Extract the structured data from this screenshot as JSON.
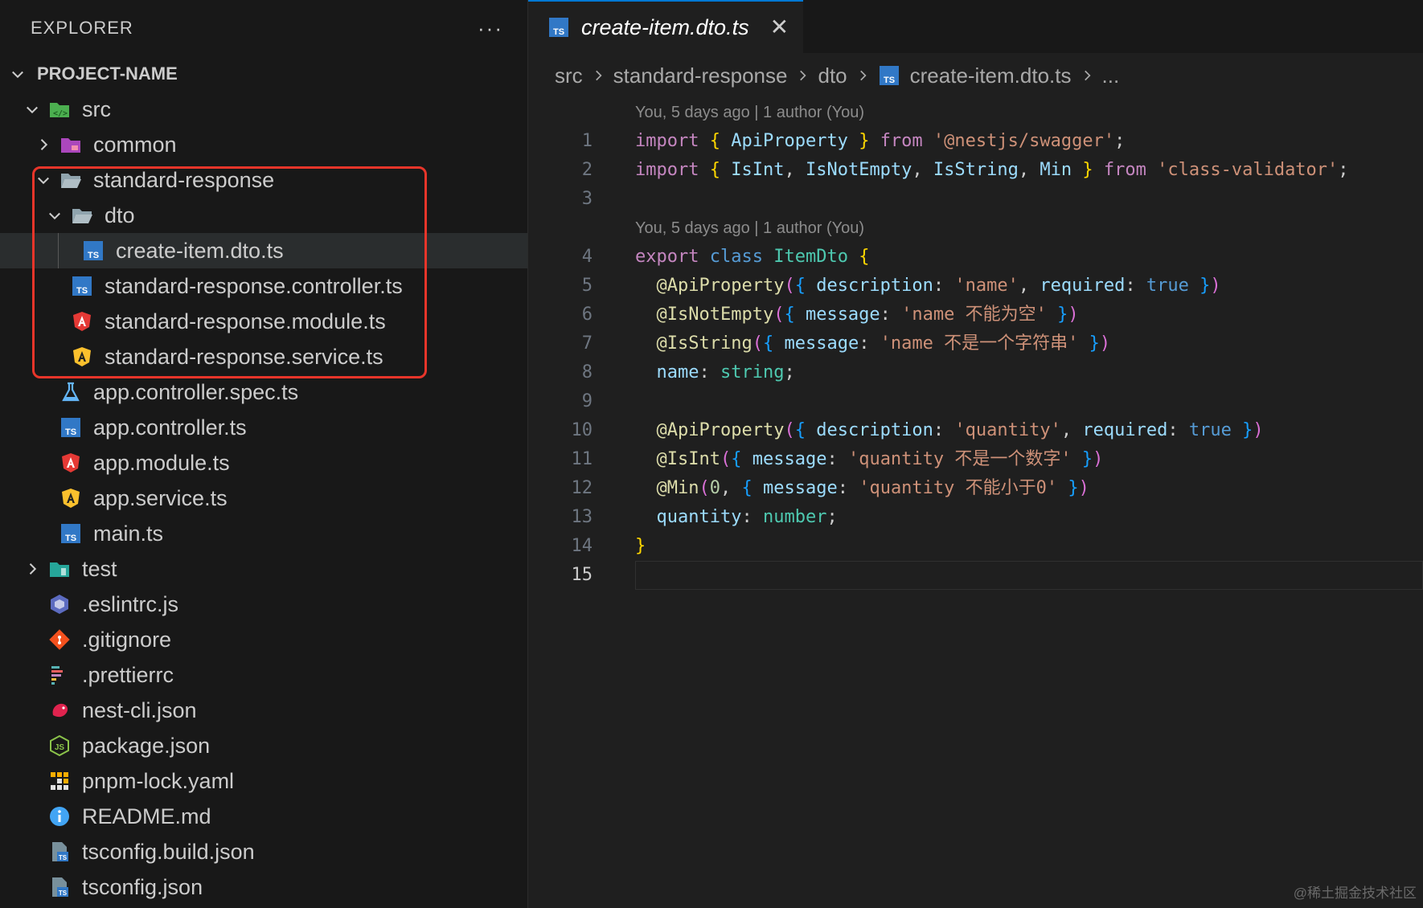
{
  "sidebar": {
    "title": "EXPLORER",
    "more_label": "···",
    "project_name": "PROJECT-NAME",
    "items": [
      {
        "label": "src",
        "icon": "folder-src-icon",
        "depth": 1,
        "expanded": true,
        "folder": true
      },
      {
        "label": "common",
        "icon": "folder-common-icon",
        "depth": 2,
        "expanded": false,
        "folder": true
      },
      {
        "label": "standard-response",
        "icon": "folder-open-icon",
        "depth": 2,
        "expanded": true,
        "folder": true
      },
      {
        "label": "dto",
        "icon": "folder-open-icon",
        "depth": 3,
        "expanded": true,
        "folder": true
      },
      {
        "label": "create-item.dto.ts",
        "icon": "typescript-icon",
        "depth": 4,
        "selected": true
      },
      {
        "label": "standard-response.controller.ts",
        "icon": "typescript-icon",
        "depth": 3
      },
      {
        "label": "standard-response.module.ts",
        "icon": "angular-module-icon",
        "depth": 3
      },
      {
        "label": "standard-response.service.ts",
        "icon": "angular-service-icon",
        "depth": 3
      },
      {
        "label": "app.controller.spec.ts",
        "icon": "test-flask-icon",
        "depth": 2
      },
      {
        "label": "app.controller.ts",
        "icon": "typescript-icon",
        "depth": 2
      },
      {
        "label": "app.module.ts",
        "icon": "angular-module-icon",
        "depth": 2
      },
      {
        "label": "app.service.ts",
        "icon": "angular-service-icon",
        "depth": 2
      },
      {
        "label": "main.ts",
        "icon": "typescript-icon",
        "depth": 2
      },
      {
        "label": "test",
        "icon": "folder-test-icon",
        "depth": 1,
        "expanded": false,
        "folder": true
      },
      {
        "label": ".eslintrc.js",
        "icon": "eslint-icon",
        "depth": 1
      },
      {
        "label": ".gitignore",
        "icon": "git-icon",
        "depth": 1
      },
      {
        "label": ".prettierrc",
        "icon": "prettier-icon",
        "depth": 1
      },
      {
        "label": "nest-cli.json",
        "icon": "nest-icon",
        "depth": 1
      },
      {
        "label": "package.json",
        "icon": "nodejs-icon",
        "depth": 1
      },
      {
        "label": "pnpm-lock.yaml",
        "icon": "pnpm-icon",
        "depth": 1
      },
      {
        "label": "README.md",
        "icon": "info-icon",
        "depth": 1
      },
      {
        "label": "tsconfig.build.json",
        "icon": "tsconfig-icon",
        "depth": 1
      },
      {
        "label": "tsconfig.json",
        "icon": "tsconfig-icon",
        "depth": 1
      }
    ]
  },
  "tab": {
    "title": "create-item.dto.ts",
    "close": "✕"
  },
  "breadcrumb": [
    "src",
    "standard-response",
    "dto",
    "create-item.dto.ts",
    "..."
  ],
  "blame": {
    "line1": "You, 5 days ago | 1 author (You)",
    "line4": "You, 5 days ago | 1 author (You)"
  },
  "code_lines": [
    {
      "n": "1",
      "tokens": [
        [
          "kw",
          "import"
        ],
        [
          "plain",
          " "
        ],
        [
          "br1",
          "{"
        ],
        [
          "plain",
          " "
        ],
        [
          "id",
          "ApiProperty"
        ],
        [
          "plain",
          " "
        ],
        [
          "br1",
          "}"
        ],
        [
          "plain",
          " "
        ],
        [
          "kw",
          "from"
        ],
        [
          "plain",
          " "
        ],
        [
          "str",
          "'@nestjs/swagger'"
        ],
        [
          "plain",
          ";"
        ]
      ]
    },
    {
      "n": "2",
      "tokens": [
        [
          "kw",
          "import"
        ],
        [
          "plain",
          " "
        ],
        [
          "br1",
          "{"
        ],
        [
          "plain",
          " "
        ],
        [
          "id",
          "IsInt"
        ],
        [
          "plain",
          ", "
        ],
        [
          "id",
          "IsNotEmpty"
        ],
        [
          "plain",
          ", "
        ],
        [
          "id",
          "IsString"
        ],
        [
          "plain",
          ", "
        ],
        [
          "id",
          "Min"
        ],
        [
          "plain",
          " "
        ],
        [
          "br1",
          "}"
        ],
        [
          "plain",
          " "
        ],
        [
          "kw",
          "from"
        ],
        [
          "plain",
          " "
        ],
        [
          "str",
          "'class-validator'"
        ],
        [
          "plain",
          ";"
        ]
      ]
    },
    {
      "n": "3",
      "tokens": []
    },
    {
      "n": "4",
      "tokens": [
        [
          "kw",
          "export"
        ],
        [
          "plain",
          " "
        ],
        [
          "kwb",
          "class"
        ],
        [
          "plain",
          " "
        ],
        [
          "cls",
          "ItemDto"
        ],
        [
          "plain",
          " "
        ],
        [
          "br1",
          "{"
        ]
      ]
    },
    {
      "n": "5",
      "tokens": [
        [
          "plain",
          "  "
        ],
        [
          "fn",
          "@ApiProperty"
        ],
        [
          "br2",
          "("
        ],
        [
          "br3",
          "{"
        ],
        [
          "plain",
          " "
        ],
        [
          "id",
          "description"
        ],
        [
          "plain",
          ": "
        ],
        [
          "str",
          "'name'"
        ],
        [
          "plain",
          ", "
        ],
        [
          "id",
          "required"
        ],
        [
          "plain",
          ": "
        ],
        [
          "kwb",
          "true"
        ],
        [
          "plain",
          " "
        ],
        [
          "br3",
          "}"
        ],
        [
          "br2",
          ")"
        ]
      ]
    },
    {
      "n": "6",
      "tokens": [
        [
          "plain",
          "  "
        ],
        [
          "fn",
          "@IsNotEmpty"
        ],
        [
          "br2",
          "("
        ],
        [
          "br3",
          "{"
        ],
        [
          "plain",
          " "
        ],
        [
          "id",
          "message"
        ],
        [
          "plain",
          ": "
        ],
        [
          "str",
          "'name 不能为空'"
        ],
        [
          "plain",
          " "
        ],
        [
          "br3",
          "}"
        ],
        [
          "br2",
          ")"
        ]
      ]
    },
    {
      "n": "7",
      "tokens": [
        [
          "plain",
          "  "
        ],
        [
          "fn",
          "@IsString"
        ],
        [
          "br2",
          "("
        ],
        [
          "br3",
          "{"
        ],
        [
          "plain",
          " "
        ],
        [
          "id",
          "message"
        ],
        [
          "plain",
          ": "
        ],
        [
          "str",
          "'name 不是一个字符串'"
        ],
        [
          "plain",
          " "
        ],
        [
          "br3",
          "}"
        ],
        [
          "br2",
          ")"
        ]
      ]
    },
    {
      "n": "8",
      "tokens": [
        [
          "plain",
          "  "
        ],
        [
          "id",
          "name"
        ],
        [
          "plain",
          ": "
        ],
        [
          "cls",
          "string"
        ],
        [
          "plain",
          ";"
        ]
      ]
    },
    {
      "n": "9",
      "tokens": []
    },
    {
      "n": "10",
      "tokens": [
        [
          "plain",
          "  "
        ],
        [
          "fn",
          "@ApiProperty"
        ],
        [
          "br2",
          "("
        ],
        [
          "br3",
          "{"
        ],
        [
          "plain",
          " "
        ],
        [
          "id",
          "description"
        ],
        [
          "plain",
          ": "
        ],
        [
          "str",
          "'quantity'"
        ],
        [
          "plain",
          ", "
        ],
        [
          "id",
          "required"
        ],
        [
          "plain",
          ": "
        ],
        [
          "kwb",
          "true"
        ],
        [
          "plain",
          " "
        ],
        [
          "br3",
          "}"
        ],
        [
          "br2",
          ")"
        ]
      ]
    },
    {
      "n": "11",
      "tokens": [
        [
          "plain",
          "  "
        ],
        [
          "fn",
          "@IsInt"
        ],
        [
          "br2",
          "("
        ],
        [
          "br3",
          "{"
        ],
        [
          "plain",
          " "
        ],
        [
          "id",
          "message"
        ],
        [
          "plain",
          ": "
        ],
        [
          "str",
          "'quantity 不是一个数字'"
        ],
        [
          "plain",
          " "
        ],
        [
          "br3",
          "}"
        ],
        [
          "br2",
          ")"
        ]
      ]
    },
    {
      "n": "12",
      "tokens": [
        [
          "plain",
          "  "
        ],
        [
          "fn",
          "@Min"
        ],
        [
          "br2",
          "("
        ],
        [
          "num",
          "0"
        ],
        [
          "plain",
          ", "
        ],
        [
          "br3",
          "{"
        ],
        [
          "plain",
          " "
        ],
        [
          "id",
          "message"
        ],
        [
          "plain",
          ": "
        ],
        [
          "str",
          "'quantity 不能小于0'"
        ],
        [
          "plain",
          " "
        ],
        [
          "br3",
          "}"
        ],
        [
          "br2",
          ")"
        ]
      ]
    },
    {
      "n": "13",
      "tokens": [
        [
          "plain",
          "  "
        ],
        [
          "id",
          "quantity"
        ],
        [
          "plain",
          ": "
        ],
        [
          "cls",
          "number"
        ],
        [
          "plain",
          ";"
        ]
      ]
    },
    {
      "n": "14",
      "tokens": [
        [
          "br1",
          "}"
        ]
      ]
    },
    {
      "n": "15",
      "tokens": [],
      "active": true
    }
  ],
  "watermark": "@稀土掘金技术社区"
}
